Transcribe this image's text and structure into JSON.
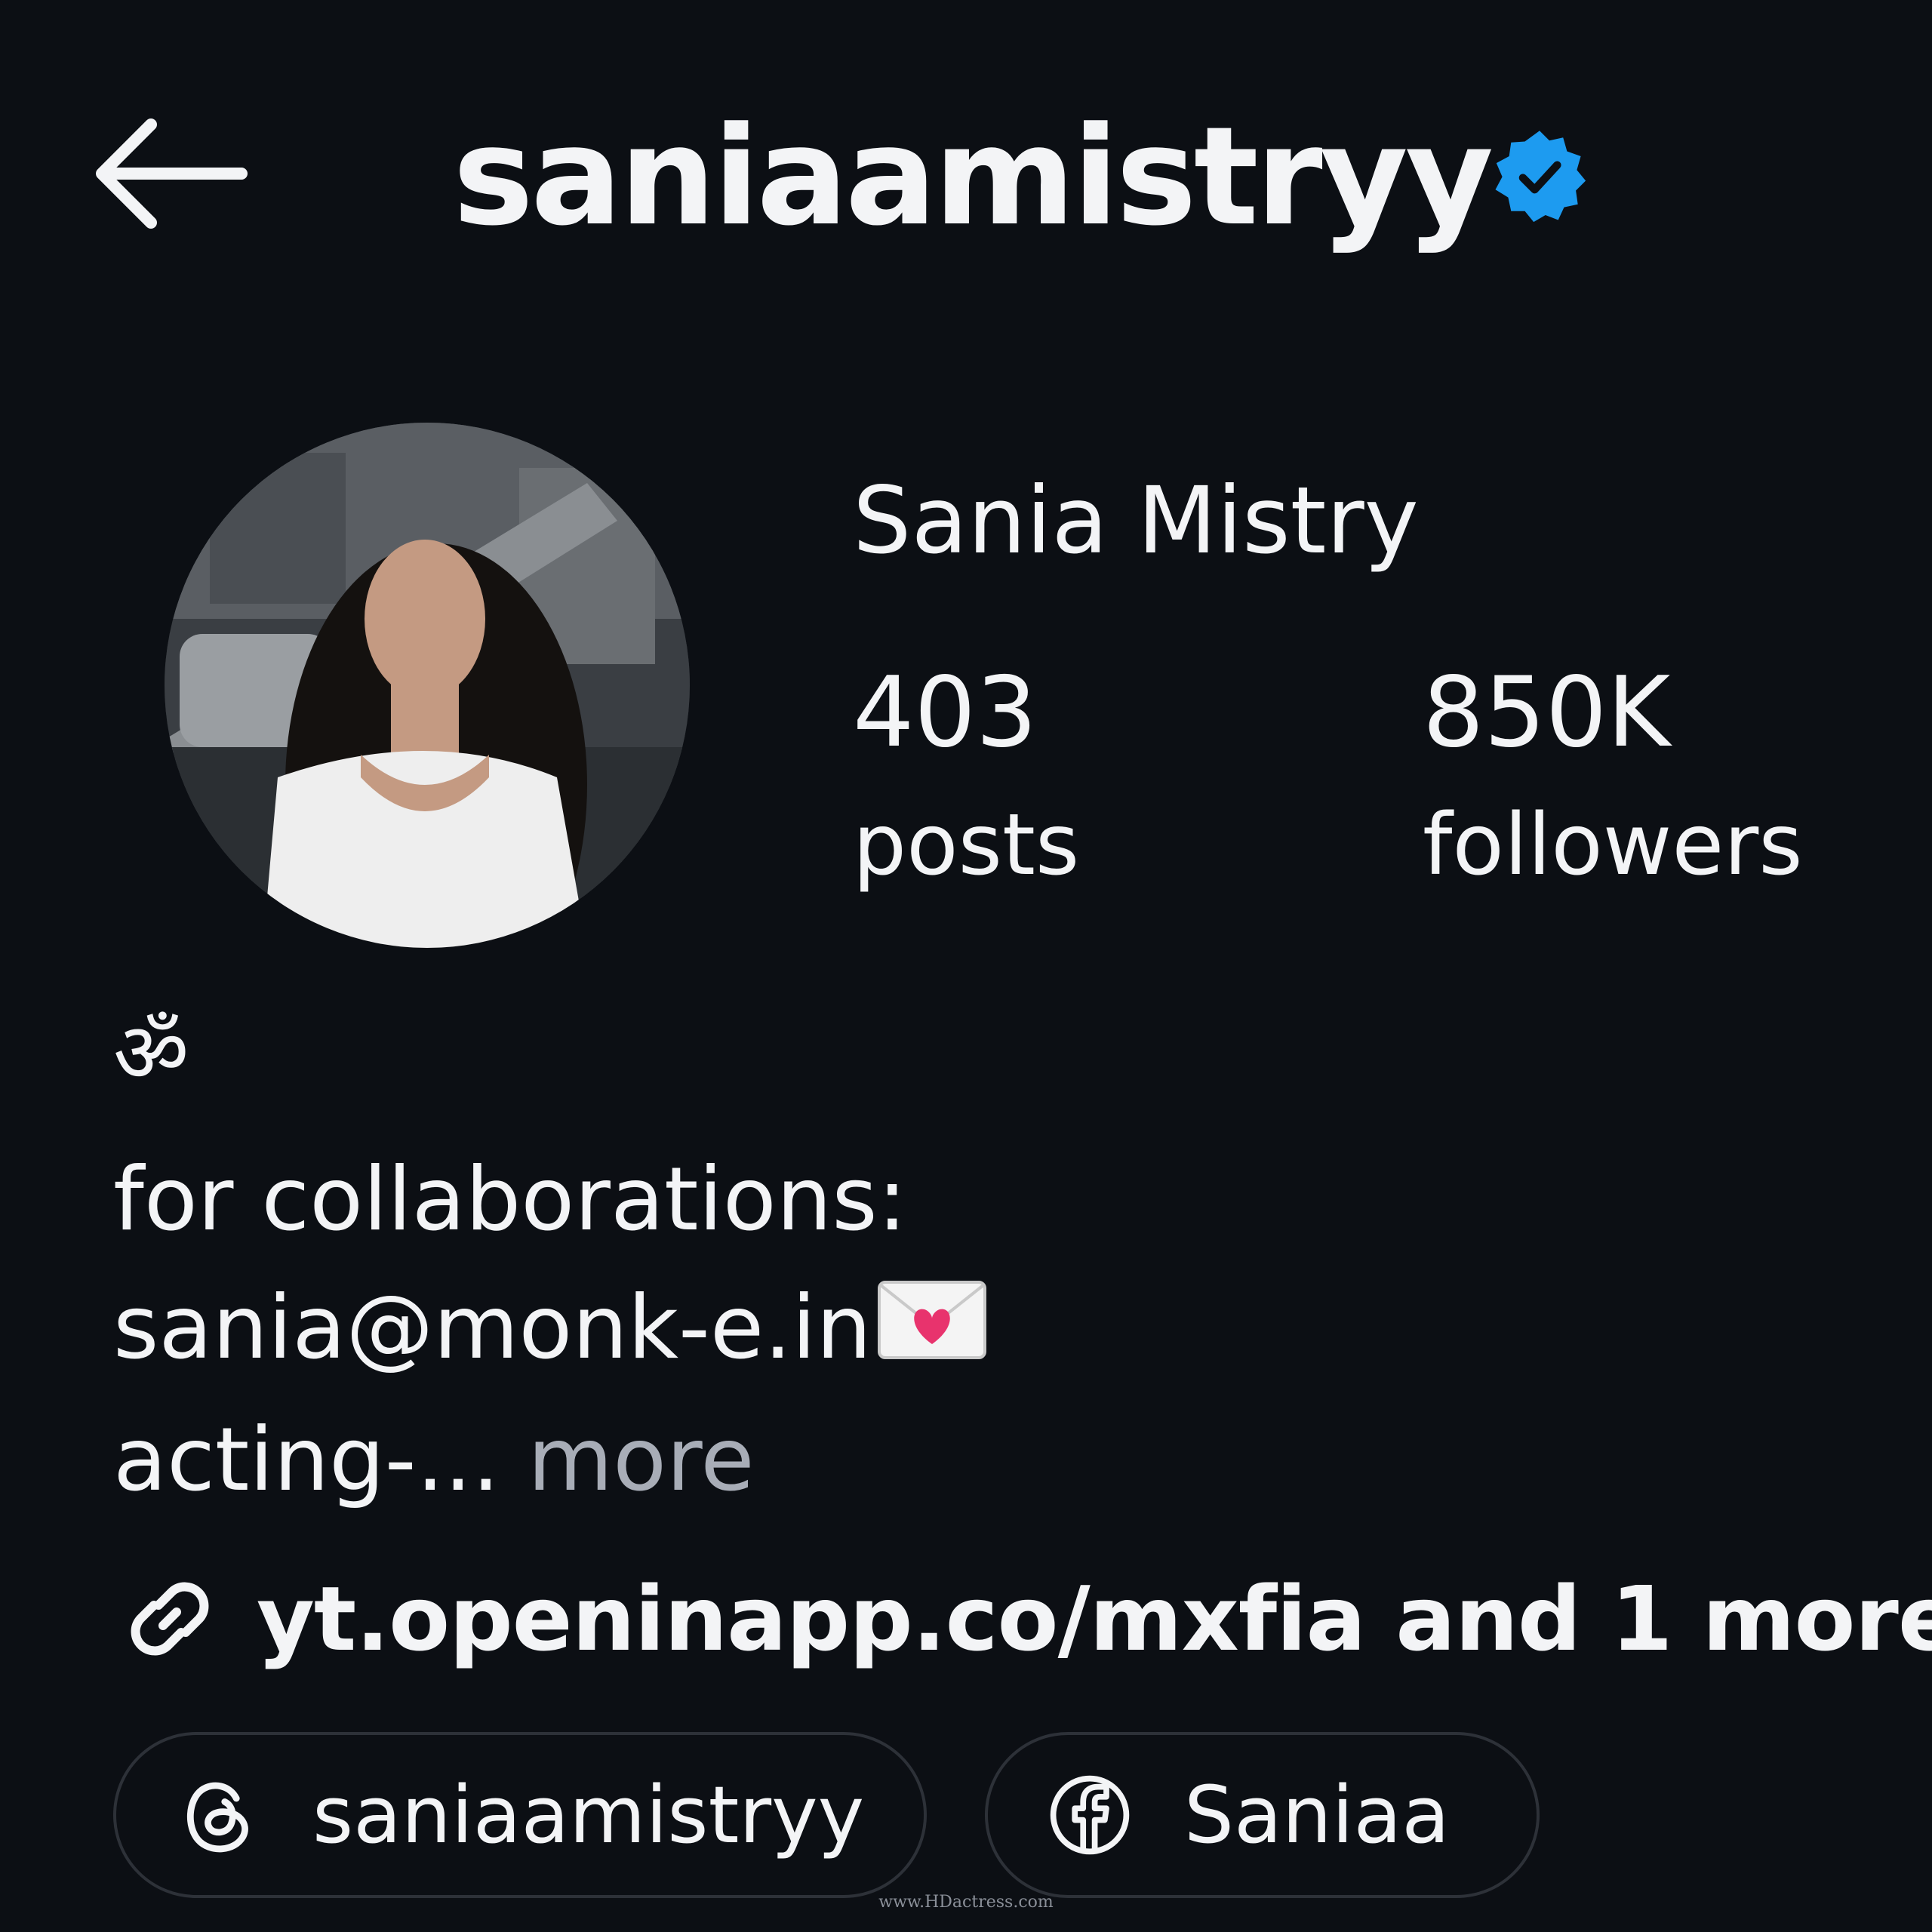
{
  "header": {
    "username": "saniaamistryy",
    "back_icon": "arrow-left-icon",
    "verified_icon": "verified-badge-icon",
    "verified_color": "#1d9bf0"
  },
  "profile": {
    "full_name": "Sania Mistry",
    "avatar_icon": "profile-photo"
  },
  "stats": {
    "posts_count": "403",
    "posts_label": "posts",
    "followers_count": "850K",
    "followers_label": "followers"
  },
  "bio": {
    "om_symbol": "ॐ",
    "line1": "for collaborations:",
    "line2": "sania@monk-e.in",
    "line2_icon": "love-letter-icon",
    "line3": "acting-...",
    "more_label": "more"
  },
  "link": {
    "icon": "link-icon",
    "text": "yt.openinapp.co/mxfia and 1 more"
  },
  "pills": {
    "threads_label": "saniaamistryy",
    "threads_icon": "threads-icon",
    "facebook_label": "Saniaa",
    "facebook_icon": "facebook-icon"
  },
  "watermark": "www.HDactress.com",
  "colors": {
    "background": "#0c0f14",
    "text": "#f3f4f6",
    "muted": "#a8adb7",
    "pill_border": "#2d3138"
  }
}
